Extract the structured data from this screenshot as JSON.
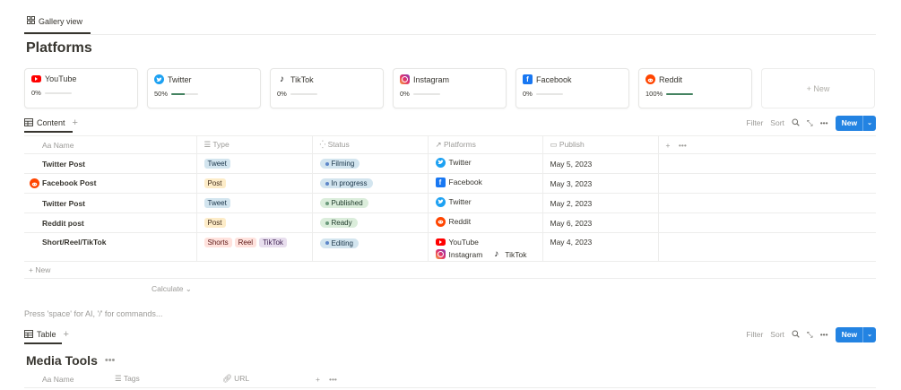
{
  "gallery_tab": "Gallery view",
  "page_title": "Platforms",
  "cards": [
    {
      "name": "YouTube",
      "logo": "youtube-icon",
      "progress_label": "0%",
      "progress": 0
    },
    {
      "name": "Twitter",
      "logo": "twitter-icon",
      "progress_label": "50%",
      "progress": 0.5
    },
    {
      "name": "TikTok",
      "logo": "tiktok-icon",
      "progress_label": "0%",
      "progress": 0
    },
    {
      "name": "Instagram",
      "logo": "instagram-icon",
      "progress_label": "0%",
      "progress": 0
    },
    {
      "name": "Facebook",
      "logo": "facebook-icon",
      "progress_label": "0%",
      "progress": 0
    },
    {
      "name": "Reddit",
      "logo": "reddit-icon",
      "progress_label": "100%",
      "progress": 1
    }
  ],
  "new_card_label": "+ New",
  "content_view": {
    "tab": "Content",
    "filter": "Filter",
    "sort": "Sort",
    "new_button": "New",
    "columns": [
      "Aa Name",
      "☰ Type",
      "Status",
      "Platforms",
      "Publish"
    ],
    "rows": [
      {
        "name": "Twitter Post",
        "type": [
          {
            "label": "Tweet",
            "color": "blue"
          }
        ],
        "status": {
          "label": "Filming",
          "color": "blue"
        },
        "platforms": [
          [
            "Twitter"
          ]
        ],
        "publish": "May 5, 2023"
      },
      {
        "name": "Facebook Post",
        "type": [
          {
            "label": "Post",
            "color": "yellow"
          }
        ],
        "status": {
          "label": "In progress",
          "color": "blue"
        },
        "platforms": [
          [
            "Facebook"
          ]
        ],
        "publish": "May 3, 2023"
      },
      {
        "name": "Twitter Post",
        "type": [
          {
            "label": "Tweet",
            "color": "blue"
          }
        ],
        "status": {
          "label": "Published",
          "color": "green"
        },
        "platforms": [
          [
            "Twitter"
          ]
        ],
        "publish": "May 2, 2023"
      },
      {
        "name": "Reddit post",
        "type": [
          {
            "label": "Post",
            "color": "yellow"
          }
        ],
        "status": {
          "label": "Ready",
          "color": "green"
        },
        "platforms": [
          [
            "Reddit"
          ]
        ],
        "publish": "May 6, 2023"
      },
      {
        "name": "Short/Reel/TikTok",
        "type": [
          {
            "label": "Shorts",
            "color": "red"
          },
          {
            "label": "Reel",
            "color": "red"
          },
          {
            "label": "TikTok",
            "color": "purple"
          }
        ],
        "status": {
          "label": "Editing",
          "color": "blue"
        },
        "platforms": [
          [
            "YouTube"
          ],
          [
            "Instagram",
            "TikTok"
          ]
        ],
        "publish": "May 4, 2023"
      }
    ],
    "add_row": "+ New",
    "calculate": "Calculate ⌄"
  },
  "hint": "Press 'space' for AI, '/' for commands...",
  "table_view": {
    "tab": "Table",
    "filter": "Filter",
    "sort": "Sort",
    "new_button": "New"
  },
  "media_tools": {
    "title": "Media Tools",
    "columns": [
      "Aa Name",
      "☰ Tags",
      "URL"
    ]
  }
}
